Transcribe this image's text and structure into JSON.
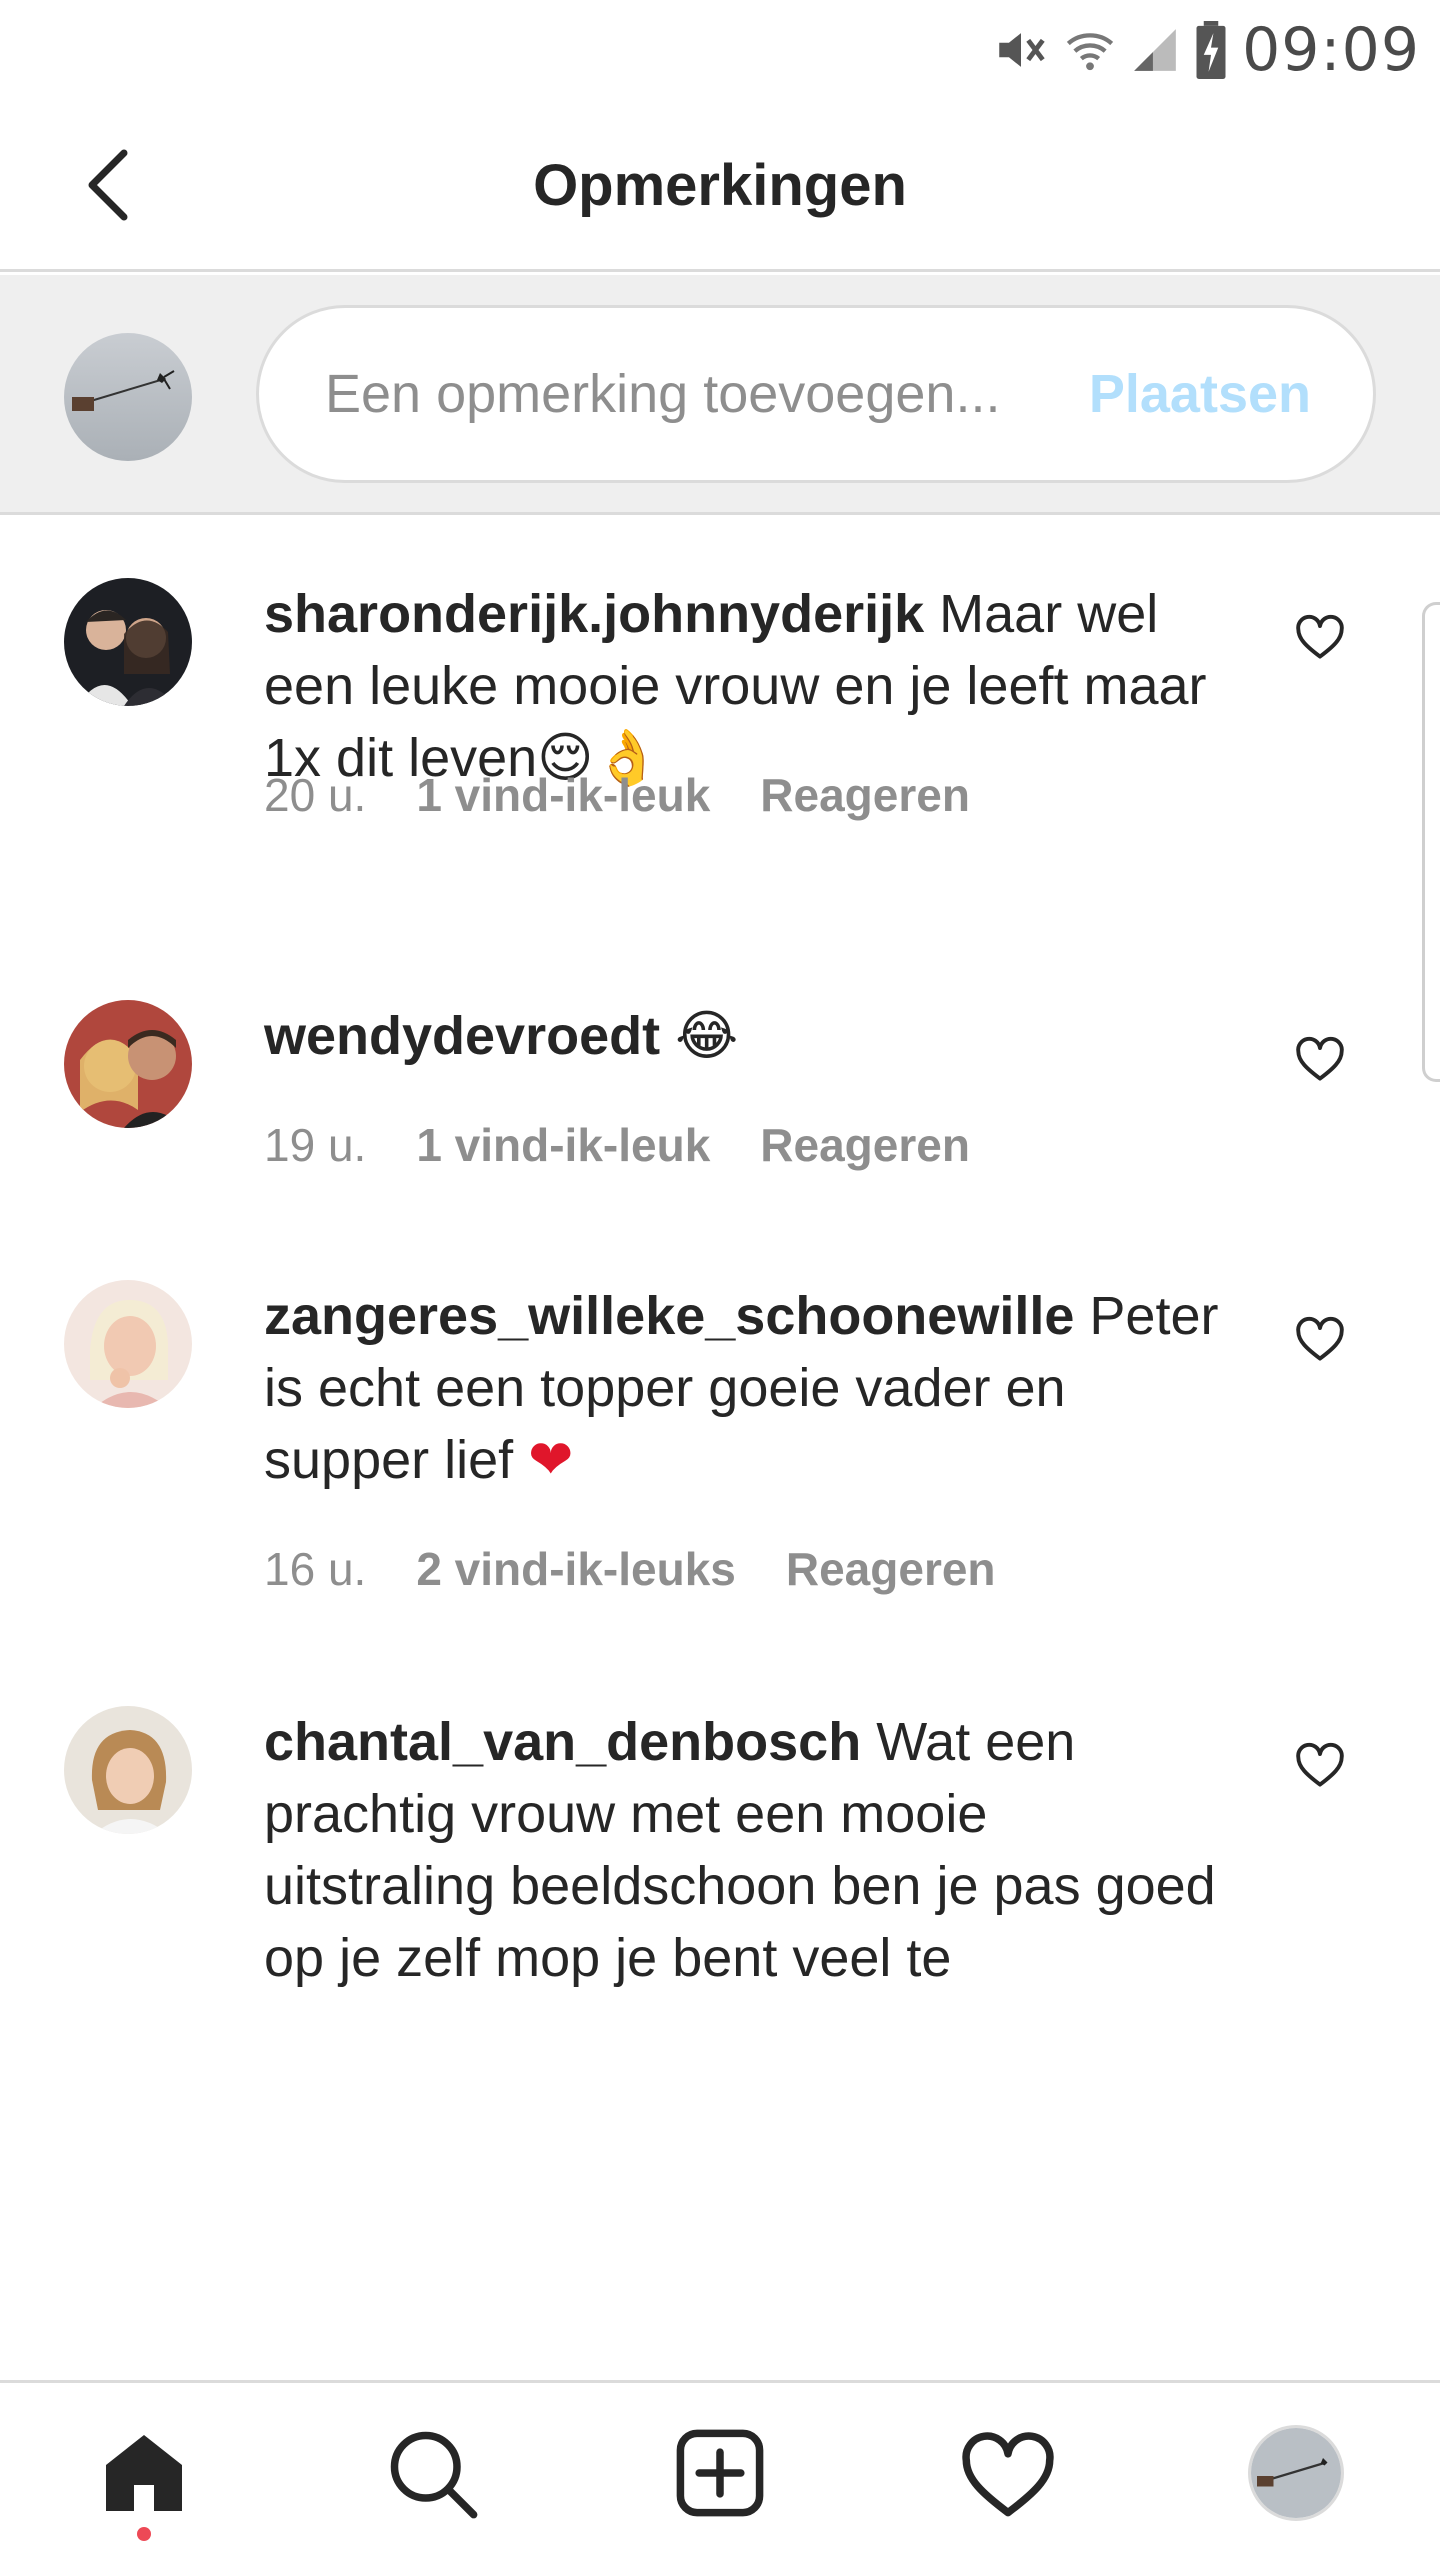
{
  "status_bar": {
    "time": "09:09",
    "icons": [
      "mute-vibrate-icon",
      "wifi-icon",
      "cell-signal-icon",
      "battery-charging-icon"
    ]
  },
  "header": {
    "title": "Opmerkingen",
    "back_icon": "chevron-left-icon"
  },
  "composer": {
    "placeholder": "Een opmerking toevoegen...",
    "post_label": "Plaatsen",
    "post_color": "#b2dffc"
  },
  "comments": [
    {
      "username": "sharonderijk.johnnyderijk",
      "text": "Maar wel een leuke mooie vrouw en je leeft maar 1x dit leven",
      "emoji": "😌👌",
      "time": "20 u.",
      "likes": "1 vind-ik-leuk",
      "reply": "Reageren"
    },
    {
      "username": "wendydevroedt",
      "text": "",
      "emoji": "😂",
      "time": "19 u.",
      "likes": "1 vind-ik-leuk",
      "reply": "Reageren"
    },
    {
      "username": "zangeres_willeke_schoonewille",
      "text": "Peter is echt een topper goeie vader en supper lief",
      "emoji": "❤",
      "time": "16 u.",
      "likes": "2 vind-ik-leuks",
      "reply": "Reageren"
    },
    {
      "username": "chantal_van_denbosch",
      "text": "Wat een prachtig vrouw met een mooie uitstraling beeldschoon ben je pas goed op je zelf mop je bent veel te",
      "emoji": "",
      "time": "",
      "likes": "",
      "reply": ""
    }
  ],
  "bottom_nav": {
    "items": [
      "home-icon",
      "search-icon",
      "new-post-icon",
      "activity-heart-icon",
      "profile-avatar"
    ],
    "notification_color": "#ed4956"
  },
  "colors": {
    "text": "#262626",
    "secondary": "#8e8e8e",
    "divider": "#dbdbdb",
    "composer_bg": "#efefef"
  }
}
